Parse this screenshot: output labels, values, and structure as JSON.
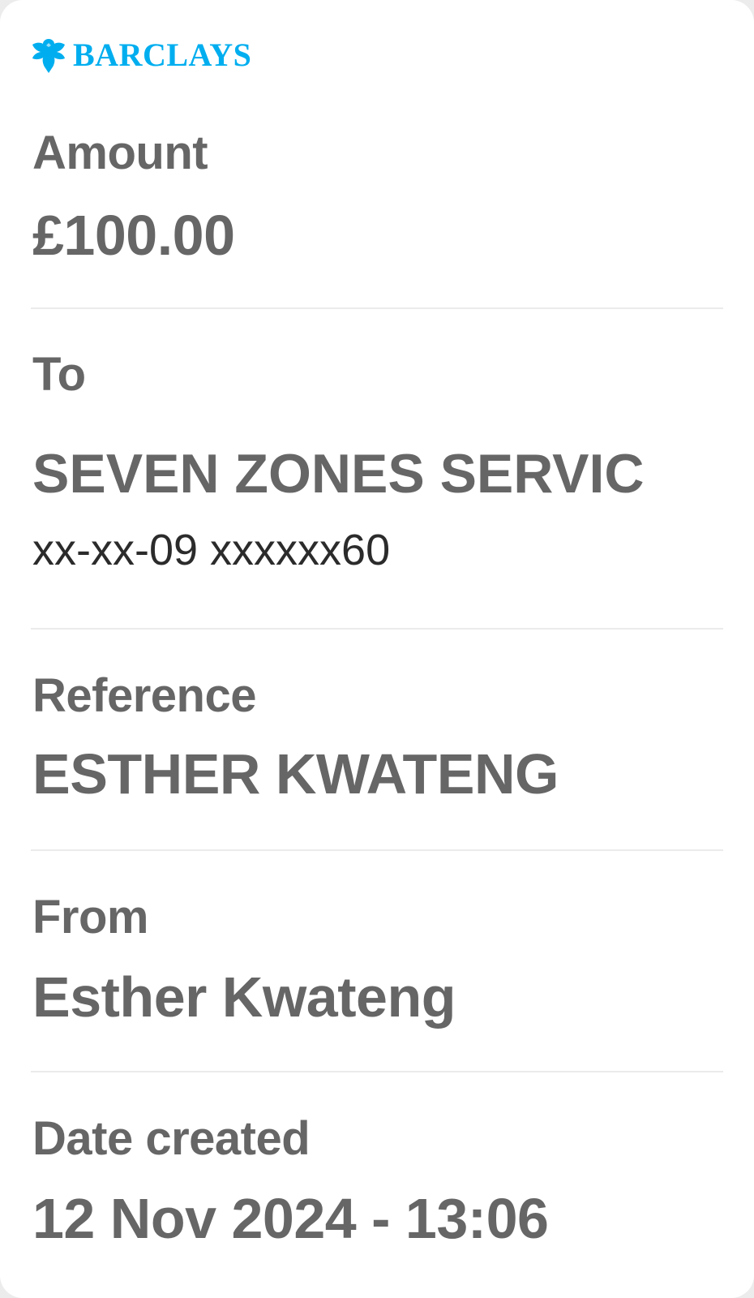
{
  "bank": {
    "name": "BARCLAYS",
    "icon": "eagle-icon",
    "brand_color": "#00aeef"
  },
  "amount": {
    "label": "Amount",
    "value": "£100.00"
  },
  "to": {
    "label": "To",
    "name": "SEVEN ZONES SERVIC",
    "account": "xx-xx-09 xxxxxx60"
  },
  "reference": {
    "label": "Reference",
    "value": "ESTHER KWATENG"
  },
  "from": {
    "label": "From",
    "value": "Esther Kwateng"
  },
  "date_created": {
    "label": "Date created",
    "value": "12 Nov 2024 - 13:06"
  }
}
